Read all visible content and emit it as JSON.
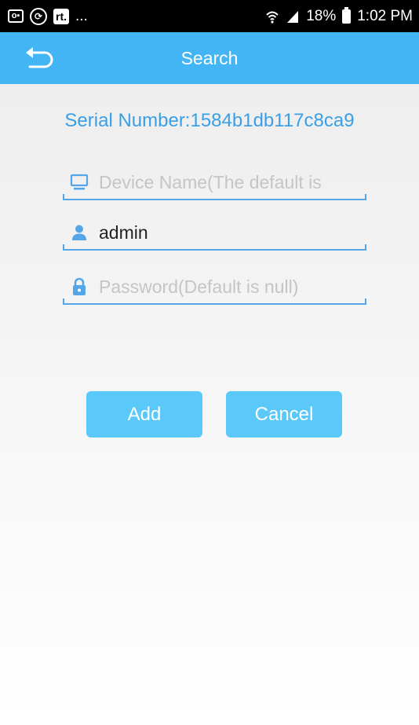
{
  "status_bar": {
    "left_icons": [
      "message-notification-icon",
      "sync-icon",
      "rt-app-icon"
    ],
    "rt_label": "rt.",
    "overflow": "...",
    "battery": "18%",
    "time": "1:02 PM"
  },
  "app_bar": {
    "title": "Search",
    "back_icon": "back-arrow-icon"
  },
  "serial": {
    "label": "Serial Number:",
    "value": "1584b1db117c8ca9"
  },
  "form": {
    "device_name": {
      "placeholder": "Device Name(The default is",
      "value": "",
      "icon": "monitor-icon"
    },
    "username": {
      "value": "admin",
      "placeholder": "",
      "icon": "user-icon"
    },
    "password": {
      "placeholder": "Password(Default is null)",
      "value": "",
      "icon": "lock-icon"
    }
  },
  "buttons": {
    "add": "Add",
    "cancel": "Cancel"
  },
  "colors": {
    "accent": "#44b5f4",
    "button": "#5ac8f8",
    "serial_text": "#3a9fe6",
    "underline": "#54a6e8"
  }
}
